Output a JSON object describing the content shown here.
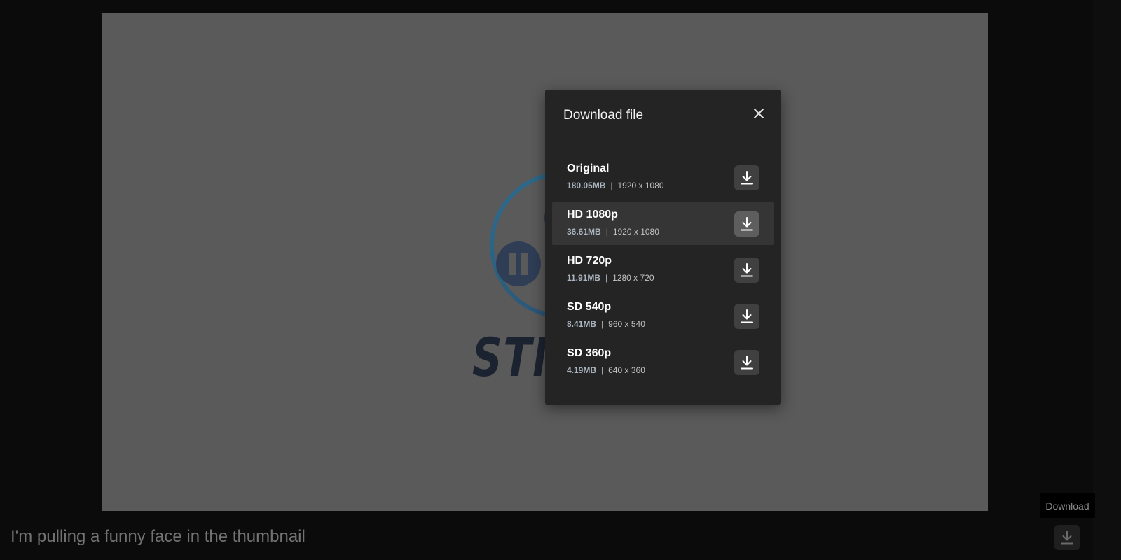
{
  "modal": {
    "title": "Download file",
    "close_icon": "close-icon",
    "options": [
      {
        "label": "Original",
        "size": "180.05MB",
        "separator": "|",
        "resolution": "1920 x 1080",
        "icon": "download-icon"
      },
      {
        "label": "HD 1080p",
        "size": "36.61MB",
        "separator": "|",
        "resolution": "1920 x 1080",
        "icon": "download-icon"
      },
      {
        "label": "HD 720p",
        "size": "11.91MB",
        "separator": "|",
        "resolution": "1280 x 720",
        "icon": "download-icon"
      },
      {
        "label": "SD 540p",
        "size": "8.41MB",
        "separator": "|",
        "resolution": "960 x 540",
        "icon": "download-icon"
      },
      {
        "label": "SD 360p",
        "size": "4.19MB",
        "separator": "|",
        "resolution": "640 x 360",
        "icon": "download-icon"
      }
    ]
  },
  "video": {
    "brand_text": "STM"
  },
  "caption": "I'm pulling a funny face in the thumbnail",
  "download_tooltip": "Download",
  "colors": {
    "page_background": "#0b0b0b",
    "video_background": "#5a5a5a",
    "modal_background": "#242424",
    "row_hover": "#353535",
    "logo_accent": "#2e5f7e"
  }
}
